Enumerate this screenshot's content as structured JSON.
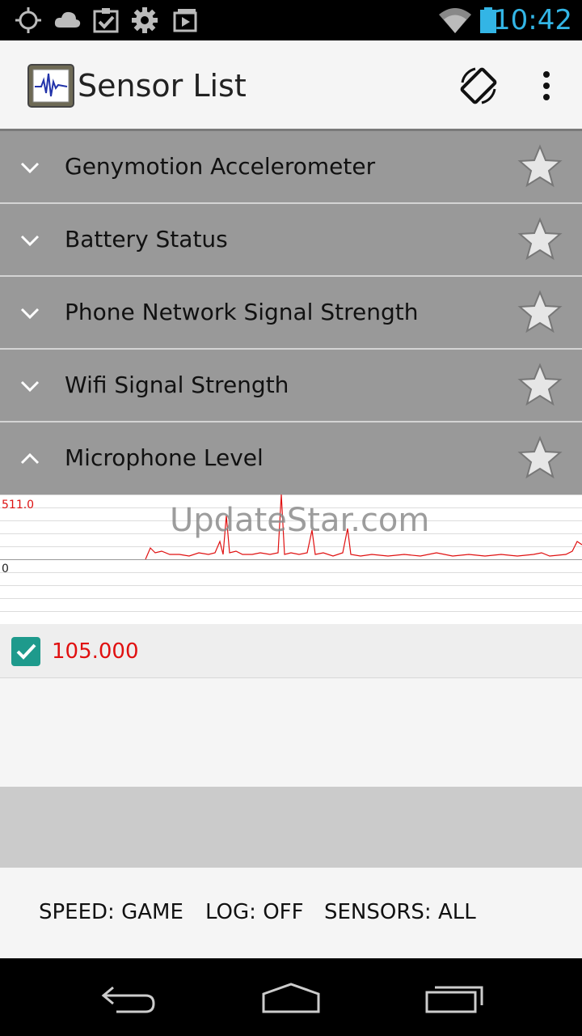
{
  "status_bar": {
    "time": "10:42",
    "icons": [
      "gps-icon",
      "cloud-icon",
      "clipboard-check-icon",
      "settings-gear-icon",
      "media-play-icon",
      "wifi-icon",
      "battery-icon"
    ]
  },
  "action_bar": {
    "title": "Sensor List",
    "icons": [
      "app-logo-icon",
      "screen-rotation-icon",
      "overflow-menu-icon"
    ]
  },
  "sensors": [
    {
      "label": "Genymotion Accelerometer",
      "expanded": false
    },
    {
      "label": "Battery Status",
      "expanded": false
    },
    {
      "label": "Phone Network Signal Strength",
      "expanded": false
    },
    {
      "label": "Wifi Signal Strength",
      "expanded": false
    },
    {
      "label": "Microphone Level",
      "expanded": true
    }
  ],
  "graph": {
    "y_max_label": "511.0",
    "y_min_label": "0",
    "watermark": "UpdateStar.com",
    "line_color": "#e01010"
  },
  "reading": {
    "checked": true,
    "value": "105.000"
  },
  "footer": {
    "speed": "SPEED: GAME",
    "log": "LOG: OFF",
    "sensors": "SENSORS: ALL"
  },
  "nav_bar": {
    "icons": [
      "back-icon",
      "home-icon",
      "recent-apps-icon"
    ]
  }
}
